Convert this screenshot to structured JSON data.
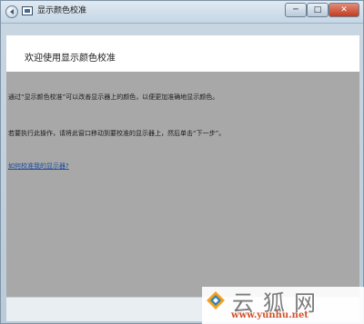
{
  "window": {
    "title": "显示颜色校准",
    "minimize_label": "─",
    "maximize_label": "□",
    "close_label": "✕"
  },
  "header": {
    "title": "欢迎使用显示颜色校准"
  },
  "main": {
    "para1": "通过“显示颜色校准”可以改善显示器上的颜色，以便更加准确地显示颜色。",
    "para2": "若要执行此操作，请将此窗口移动到要校准的显示器上，然后单击“下一步”。",
    "help_link": "如何校准我的显示器?"
  },
  "watermark": {
    "site_name": "云狐网",
    "url": "www.yunhu.net"
  },
  "colors": {
    "content_bg": "#a8a8a8",
    "link": "#1b4b9c",
    "watermark_url": "#d2512a"
  }
}
